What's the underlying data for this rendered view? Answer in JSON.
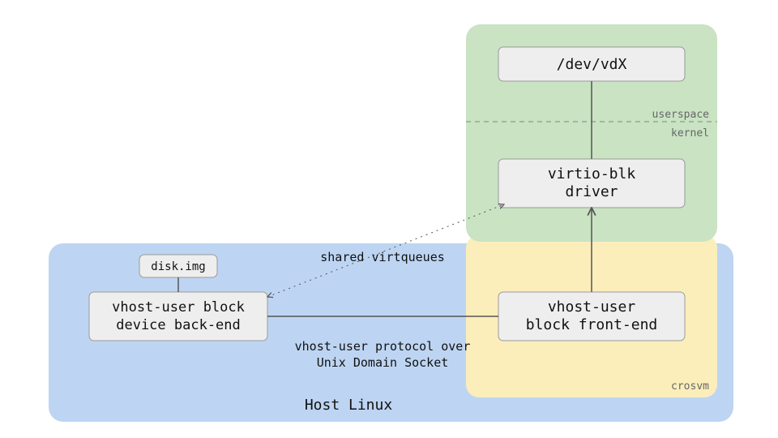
{
  "diagram": {
    "host_label": "Host Linux",
    "crosvm_label": "crosvm",
    "guest": {
      "userspace_label": "userspace",
      "kernel_label": "kernel",
      "dev_vdx": "/dev/vdX",
      "virtio_blk_driver_l1": "virtio-blk",
      "virtio_blk_driver_l2": "driver"
    },
    "backend": {
      "disk_img": "disk.img",
      "vhost_backend_l1": "vhost-user block",
      "vhost_backend_l2": "device back-end"
    },
    "frontend": {
      "vhost_frontend_l1": "vhost-user",
      "vhost_frontend_l2": "block front-end"
    },
    "edges": {
      "shared_virtqueues": "shared virtqueues",
      "vhost_protocol_l1": "vhost-user protocol over",
      "vhost_protocol_l2": "Unix Domain Socket"
    }
  },
  "colors": {
    "host_bg": "#bdd5f2",
    "guest_bg": "#c9e3c3",
    "crosvm_bg": "#fbeebb",
    "node_bg": "#eeeeee",
    "node_stroke": "#9a9a9a",
    "line": "#555555",
    "dash": "#888888"
  }
}
